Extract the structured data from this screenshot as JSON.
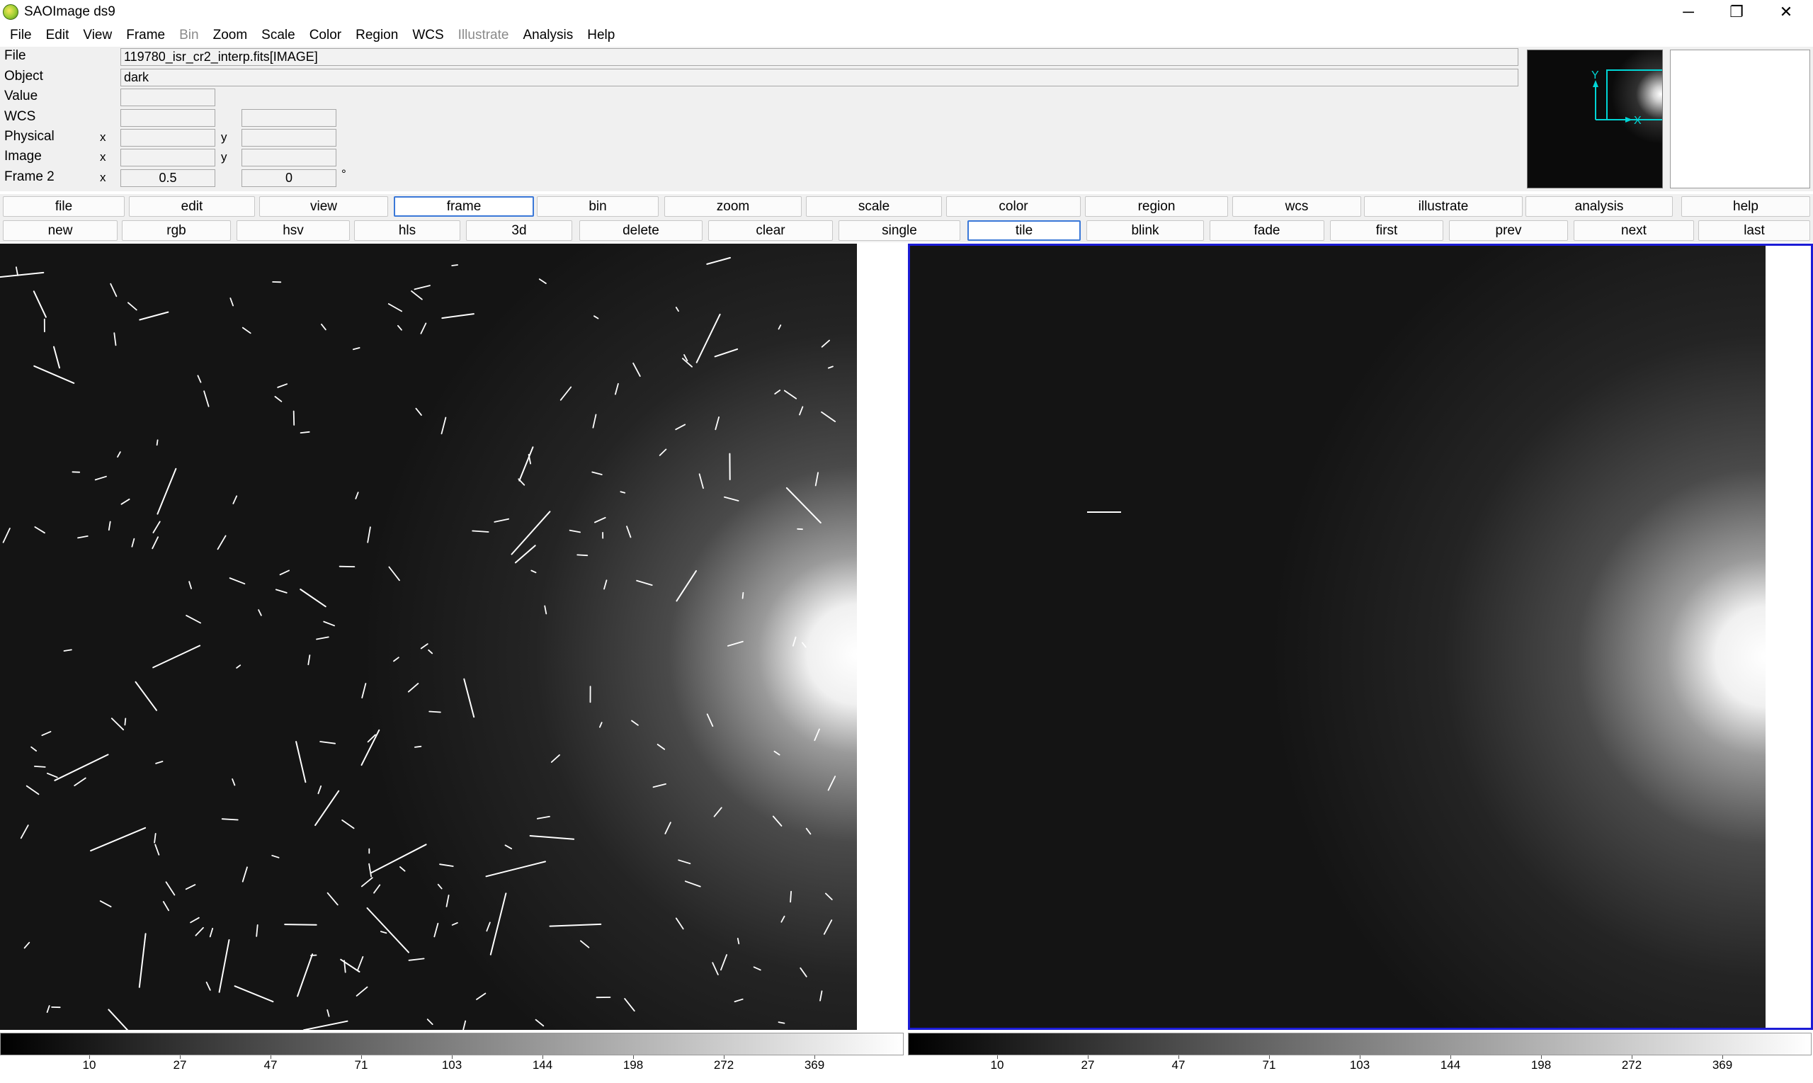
{
  "window": {
    "title": "SAOImage ds9",
    "min_glyph": "─",
    "max_glyph": "❐",
    "close_glyph": "✕"
  },
  "menu": [
    {
      "label": "File",
      "enabled": true
    },
    {
      "label": "Edit",
      "enabled": true
    },
    {
      "label": "View",
      "enabled": true
    },
    {
      "label": "Frame",
      "enabled": true
    },
    {
      "label": "Bin",
      "enabled": false
    },
    {
      "label": "Zoom",
      "enabled": true
    },
    {
      "label": "Scale",
      "enabled": true
    },
    {
      "label": "Color",
      "enabled": true
    },
    {
      "label": "Region",
      "enabled": true
    },
    {
      "label": "WCS",
      "enabled": true
    },
    {
      "label": "Illustrate",
      "enabled": false
    },
    {
      "label": "Analysis",
      "enabled": true
    },
    {
      "label": "Help",
      "enabled": true
    }
  ],
  "info": {
    "file_label": "File",
    "file_value": "119780_isr_cr2_interp.fits[IMAGE]",
    "object_label": "Object",
    "object_value": "dark",
    "value_label": "Value",
    "value_value": "",
    "wcs_label": "WCS",
    "physical_label": "Physical",
    "image_label": "Image",
    "frame_label": "Frame 2",
    "x_axis": "x",
    "y_axis": "y",
    "frame_zoom": "0.5",
    "frame_angle": "0",
    "degree_symbol": "°"
  },
  "panner": {
    "y_label": "Y",
    "x_label": "X"
  },
  "main_buttons": [
    {
      "label": "file",
      "active": false
    },
    {
      "label": "edit",
      "active": false
    },
    {
      "label": "view",
      "active": false
    },
    {
      "label": "frame",
      "active": true
    },
    {
      "label": "bin",
      "active": false
    },
    {
      "label": "zoom",
      "active": false
    },
    {
      "label": "scale",
      "active": false
    },
    {
      "label": "color",
      "active": false
    },
    {
      "label": "region",
      "active": false
    },
    {
      "label": "wcs",
      "active": false
    },
    {
      "label": "illustrate",
      "active": false
    },
    {
      "label": "analysis",
      "active": false
    },
    {
      "label": "help",
      "active": false
    }
  ],
  "frame_buttons": [
    {
      "label": "new",
      "active": false
    },
    {
      "label": "rgb",
      "active": false
    },
    {
      "label": "hsv",
      "active": false
    },
    {
      "label": "hls",
      "active": false
    },
    {
      "label": "3d",
      "active": false
    },
    {
      "label": "delete",
      "active": false
    },
    {
      "label": "clear",
      "active": false
    },
    {
      "label": "single",
      "active": false
    },
    {
      "label": "tile",
      "active": true
    },
    {
      "label": "blink",
      "active": false
    },
    {
      "label": "fade",
      "active": false
    },
    {
      "label": "first",
      "active": false
    },
    {
      "label": "prev",
      "active": false
    },
    {
      "label": "next",
      "active": false
    },
    {
      "label": "last",
      "active": false
    }
  ],
  "colorbar_ticks": [
    "10",
    "27",
    "47",
    "71",
    "103",
    "144",
    "198",
    "272",
    "369"
  ]
}
